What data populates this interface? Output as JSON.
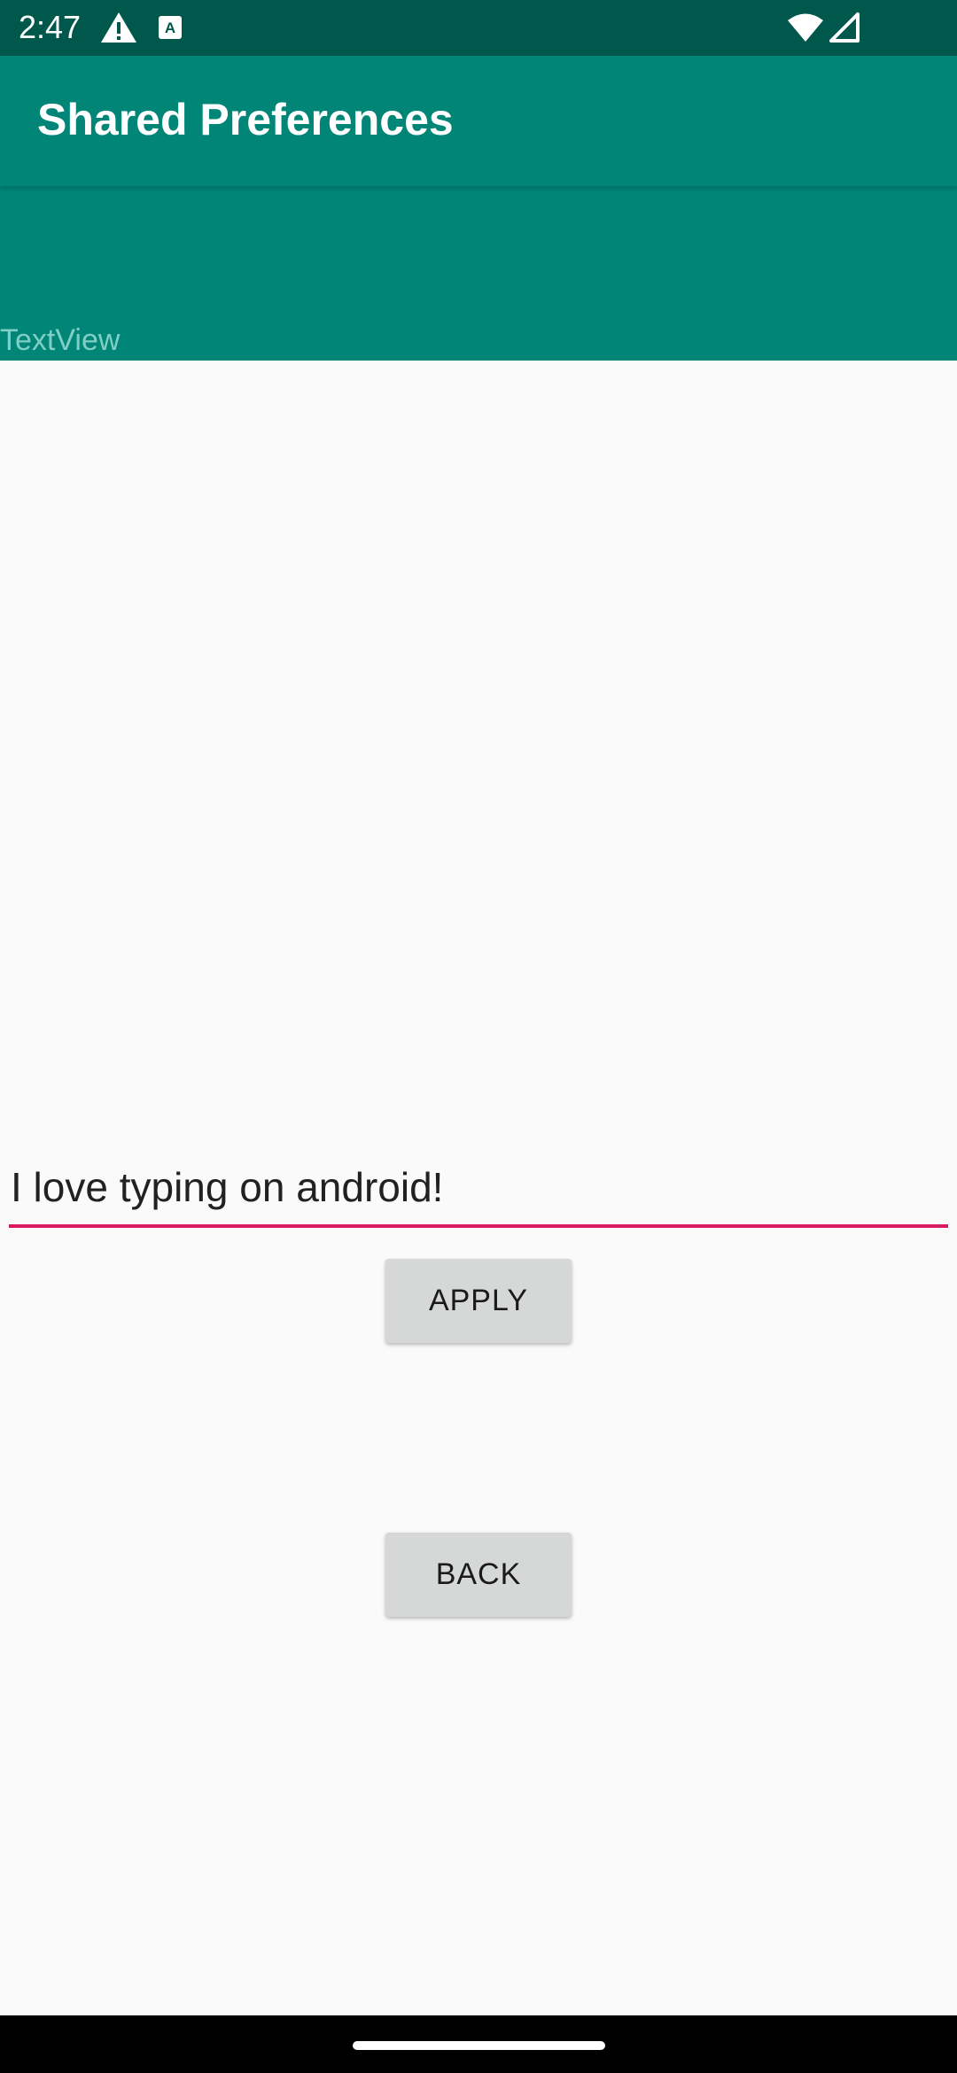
{
  "status_bar": {
    "time": "2:47",
    "icons": [
      "alert-icon",
      "keyboard-a-icon",
      "wifi-icon",
      "cellular-signal-icon"
    ],
    "background": "#00574b"
  },
  "app_bar": {
    "title": "Shared Preferences",
    "background": "#008577"
  },
  "header_panel": {
    "text": "TextView"
  },
  "form": {
    "input_value": "I love typing on android!",
    "underline_color": "#d81b60",
    "apply_label": "APPLY",
    "back_label": "BACK"
  }
}
